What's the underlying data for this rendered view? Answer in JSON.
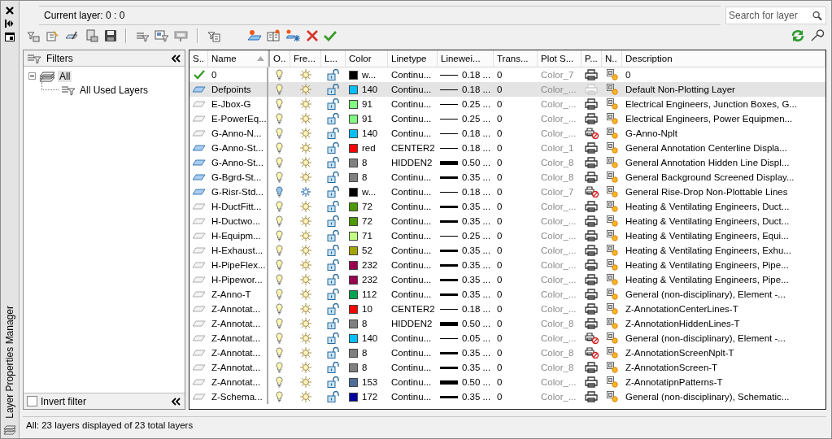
{
  "window": {
    "title": "Layer Properties Manager"
  },
  "current_layer": "Current layer: 0 : 0",
  "search": {
    "placeholder": "Search for layer"
  },
  "filters": {
    "title": "Filters",
    "tree": [
      {
        "label": "All",
        "expanded": true,
        "selected": true,
        "children": [
          {
            "label": "All Used Layers",
            "selected": false
          }
        ]
      }
    ],
    "invert_filter": {
      "label": "Invert filter",
      "checked": false
    }
  },
  "table": {
    "columns": [
      {
        "label": "S..",
        "sorted": false
      },
      {
        "label": "Name",
        "sorted": true
      },
      {
        "label": "O..",
        "sorted": false
      },
      {
        "label": "Fre...",
        "sorted": false
      },
      {
        "label": "L...",
        "sorted": false
      },
      {
        "label": "Color",
        "sorted": false
      },
      {
        "label": "Linetype",
        "sorted": false
      },
      {
        "label": "Linewei...",
        "sorted": false
      },
      {
        "label": "Trans...",
        "sorted": false
      },
      {
        "label": "Plot S...",
        "sorted": false
      },
      {
        "label": "P...",
        "sorted": false
      },
      {
        "label": "N..",
        "sorted": false
      },
      {
        "label": "Description",
        "sorted": false
      }
    ],
    "rows": [
      {
        "current": true,
        "in_use": true,
        "selected": false,
        "name": "0",
        "on": true,
        "frozen": false,
        "locked": false,
        "color": "#000000",
        "color_name": "w...",
        "linetype": "Continu...",
        "lineweight": {
          "kind": "thin",
          "label": "0.18 ..."
        },
        "transparency": "0",
        "plot_style": "Color_7",
        "plot": true,
        "plot_disabled": false,
        "description": "0"
      },
      {
        "current": false,
        "in_use": true,
        "selected": true,
        "name": "Defpoints",
        "on": true,
        "frozen": false,
        "locked": false,
        "color": "#00bfff",
        "color_name": "140",
        "linetype": "Continu...",
        "lineweight": {
          "kind": "thin",
          "label": "0.18 ..."
        },
        "transparency": "0",
        "plot_style": "Color_...",
        "plot": true,
        "plot_disabled": true,
        "description": "Default Non-Plotting Layer"
      },
      {
        "current": false,
        "in_use": false,
        "selected": false,
        "name": "E-Jbox-G",
        "on": true,
        "frozen": false,
        "locked": false,
        "color": "#80ff80",
        "color_name": "91",
        "linetype": "Continu...",
        "lineweight": {
          "kind": "thin",
          "label": "0.25 ..."
        },
        "transparency": "0",
        "plot_style": "Color_...",
        "plot": true,
        "plot_disabled": false,
        "description": "Electrical Engineers, Junction Boxes, G..."
      },
      {
        "current": false,
        "in_use": false,
        "selected": false,
        "name": "E-PowerEq...",
        "on": true,
        "frozen": false,
        "locked": false,
        "color": "#80ff80",
        "color_name": "91",
        "linetype": "Continu...",
        "lineweight": {
          "kind": "thin",
          "label": "0.25 ..."
        },
        "transparency": "0",
        "plot_style": "Color_...",
        "plot": true,
        "plot_disabled": false,
        "description": "Electrical Engineers, Power Equipmen..."
      },
      {
        "current": false,
        "in_use": false,
        "selected": false,
        "name": "G-Anno-N...",
        "on": true,
        "frozen": false,
        "locked": false,
        "color": "#00bfff",
        "color_name": "140",
        "linetype": "Continu...",
        "lineweight": {
          "kind": "thin",
          "label": "0.18 ..."
        },
        "transparency": "0",
        "plot_style": "Color_...",
        "plot": false,
        "plot_disabled": false,
        "description": "G-Anno-Nplt"
      },
      {
        "current": false,
        "in_use": true,
        "selected": false,
        "name": "G-Anno-St...",
        "on": true,
        "frozen": false,
        "locked": false,
        "color": "#ff0000",
        "color_name": "red",
        "linetype": "CENTER2",
        "lineweight": {
          "kind": "thin",
          "label": "0.18 ..."
        },
        "transparency": "0",
        "plot_style": "Color_1",
        "plot": true,
        "plot_disabled": false,
        "description": "General Annotation Centerline Displa..."
      },
      {
        "current": false,
        "in_use": true,
        "selected": false,
        "name": "G-Anno-St...",
        "on": true,
        "frozen": false,
        "locked": false,
        "color": "#808080",
        "color_name": "8",
        "linetype": "HIDDEN2",
        "lineweight": {
          "kind": "heavy",
          "label": "0.50 ..."
        },
        "transparency": "0",
        "plot_style": "Color_8",
        "plot": true,
        "plot_disabled": false,
        "description": "General Annotation Hidden Line Displ..."
      },
      {
        "current": false,
        "in_use": true,
        "selected": false,
        "name": "G-Bgrd-St...",
        "on": true,
        "frozen": false,
        "locked": false,
        "color": "#808080",
        "color_name": "8",
        "linetype": "Continu...",
        "lineweight": {
          "kind": "thick",
          "label": "0.35 ..."
        },
        "transparency": "0",
        "plot_style": "Color_8",
        "plot": true,
        "plot_disabled": false,
        "description": "General Background Screened Display..."
      },
      {
        "current": false,
        "in_use": true,
        "selected": false,
        "name": "G-Risr-Std...",
        "on": false,
        "frozen": true,
        "locked": false,
        "color": "#000000",
        "color_name": "w...",
        "linetype": "Continu...",
        "lineweight": {
          "kind": "thin",
          "label": "0.18 ..."
        },
        "transparency": "0",
        "plot_style": "Color_7",
        "plot": false,
        "plot_disabled": false,
        "description": "General Rise-Drop Non-Plottable Lines"
      },
      {
        "current": false,
        "in_use": false,
        "selected": false,
        "name": "H-DuctFitt...",
        "on": true,
        "frozen": false,
        "locked": false,
        "color": "#4c9900",
        "color_name": "72",
        "linetype": "Continu...",
        "lineweight": {
          "kind": "thick",
          "label": "0.35 ..."
        },
        "transparency": "0",
        "plot_style": "Color_...",
        "plot": true,
        "plot_disabled": false,
        "description": "Heating & Ventilating Engineers, Duct..."
      },
      {
        "current": false,
        "in_use": false,
        "selected": false,
        "name": "H-Ductwo...",
        "on": true,
        "frozen": false,
        "locked": false,
        "color": "#4c9900",
        "color_name": "72",
        "linetype": "Continu...",
        "lineweight": {
          "kind": "thick",
          "label": "0.35 ..."
        },
        "transparency": "0",
        "plot_style": "Color_...",
        "plot": true,
        "plot_disabled": false,
        "description": "Heating & Ventilating Engineers, Duct..."
      },
      {
        "current": false,
        "in_use": false,
        "selected": false,
        "name": "H-Equipm...",
        "on": true,
        "frozen": false,
        "locked": false,
        "color": "#c0ff80",
        "color_name": "71",
        "linetype": "Continu...",
        "lineweight": {
          "kind": "thin",
          "label": "0.25 ..."
        },
        "transparency": "0",
        "plot_style": "Color_...",
        "plot": true,
        "plot_disabled": false,
        "description": "Heating & Ventilating Engineers, Equi..."
      },
      {
        "current": false,
        "in_use": false,
        "selected": false,
        "name": "H-Exhaust...",
        "on": true,
        "frozen": false,
        "locked": false,
        "color": "#a5a500",
        "color_name": "52",
        "linetype": "Continu...",
        "lineweight": {
          "kind": "thick",
          "label": "0.35 ..."
        },
        "transparency": "0",
        "plot_style": "Color_...",
        "plot": true,
        "plot_disabled": false,
        "description": "Heating & Ventilating Engineers, Exhu..."
      },
      {
        "current": false,
        "in_use": false,
        "selected": false,
        "name": "H-PipeFlex...",
        "on": true,
        "frozen": false,
        "locked": false,
        "color": "#990050",
        "color_name": "232",
        "linetype": "Continu...",
        "lineweight": {
          "kind": "thick",
          "label": "0.35 ..."
        },
        "transparency": "0",
        "plot_style": "Color_...",
        "plot": true,
        "plot_disabled": false,
        "description": "Heating & Ventilating Engineers, Pipe..."
      },
      {
        "current": false,
        "in_use": false,
        "selected": false,
        "name": "H-Pipewor...",
        "on": true,
        "frozen": false,
        "locked": false,
        "color": "#990050",
        "color_name": "232",
        "linetype": "Continu...",
        "lineweight": {
          "kind": "thick",
          "label": "0.35 ..."
        },
        "transparency": "0",
        "plot_style": "Color_...",
        "plot": true,
        "plot_disabled": false,
        "description": "Heating & Ventilating Engineers, Pipe..."
      },
      {
        "current": false,
        "in_use": false,
        "selected": false,
        "name": "Z-Anno-T",
        "on": true,
        "frozen": false,
        "locked": false,
        "color": "#00a550",
        "color_name": "112",
        "linetype": "Continu...",
        "lineweight": {
          "kind": "thick",
          "label": "0.35 ..."
        },
        "transparency": "0",
        "plot_style": "Color_...",
        "plot": true,
        "plot_disabled": false,
        "description": "General (non-disciplinary), Element -..."
      },
      {
        "current": false,
        "in_use": false,
        "selected": false,
        "name": "Z-Annotat...",
        "on": true,
        "frozen": false,
        "locked": false,
        "color": "#ff0000",
        "color_name": "10",
        "linetype": "CENTER2",
        "lineweight": {
          "kind": "thin",
          "label": "0.18 ..."
        },
        "transparency": "0",
        "plot_style": "Color_...",
        "plot": true,
        "plot_disabled": false,
        "description": "Z-AnnotationCenterLines-T"
      },
      {
        "current": false,
        "in_use": false,
        "selected": false,
        "name": "Z-Annotat...",
        "on": true,
        "frozen": false,
        "locked": false,
        "color": "#808080",
        "color_name": "8",
        "linetype": "HIDDEN2",
        "lineweight": {
          "kind": "heavy",
          "label": "0.50 ..."
        },
        "transparency": "0",
        "plot_style": "Color_8",
        "plot": true,
        "plot_disabled": false,
        "description": "Z-AnnotationHiddenLines-T"
      },
      {
        "current": false,
        "in_use": false,
        "selected": false,
        "name": "Z-Annotat...",
        "on": true,
        "frozen": false,
        "locked": false,
        "color": "#00bfff",
        "color_name": "140",
        "linetype": "Continu...",
        "lineweight": {
          "kind": "thin",
          "label": "0.05 ..."
        },
        "transparency": "0",
        "plot_style": "Color_...",
        "plot": false,
        "plot_disabled": false,
        "description": "General (non-disciplinary), Element -..."
      },
      {
        "current": false,
        "in_use": false,
        "selected": false,
        "name": "Z-Annotat...",
        "on": true,
        "frozen": false,
        "locked": false,
        "color": "#808080",
        "color_name": "8",
        "linetype": "Continu...",
        "lineweight": {
          "kind": "thick",
          "label": "0.35 ..."
        },
        "transparency": "0",
        "plot_style": "Color_8",
        "plot": false,
        "plot_disabled": false,
        "description": "Z-AnnotationScreenNplt-T"
      },
      {
        "current": false,
        "in_use": false,
        "selected": false,
        "name": "Z-Annotat...",
        "on": true,
        "frozen": false,
        "locked": false,
        "color": "#808080",
        "color_name": "8",
        "linetype": "Continu...",
        "lineweight": {
          "kind": "thick",
          "label": "0.35 ..."
        },
        "transparency": "0",
        "plot_style": "Color_8",
        "plot": true,
        "plot_disabled": false,
        "description": "Z-AnnotationScreen-T"
      },
      {
        "current": false,
        "in_use": false,
        "selected": false,
        "name": "Z-Annotat...",
        "on": true,
        "frozen": false,
        "locked": false,
        "color": "#4c6f99",
        "color_name": "153",
        "linetype": "Continu...",
        "lineweight": {
          "kind": "heavy",
          "label": "0.50 ..."
        },
        "transparency": "0",
        "plot_style": "Color_...",
        "plot": true,
        "plot_disabled": false,
        "description": "Z-AnnotatipnPatterns-T"
      },
      {
        "current": false,
        "in_use": false,
        "selected": false,
        "name": "Z-Schema...",
        "on": true,
        "frozen": false,
        "locked": false,
        "color": "#00009f",
        "color_name": "172",
        "linetype": "Continu...",
        "lineweight": {
          "kind": "thick",
          "label": "0.35 ..."
        },
        "transparency": "0",
        "plot_style": "Color_...",
        "plot": true,
        "plot_disabled": false,
        "description": "General (non-disciplinary), Schematic..."
      }
    ]
  },
  "status_bar": "All: 23 layers displayed of 23 total layers"
}
